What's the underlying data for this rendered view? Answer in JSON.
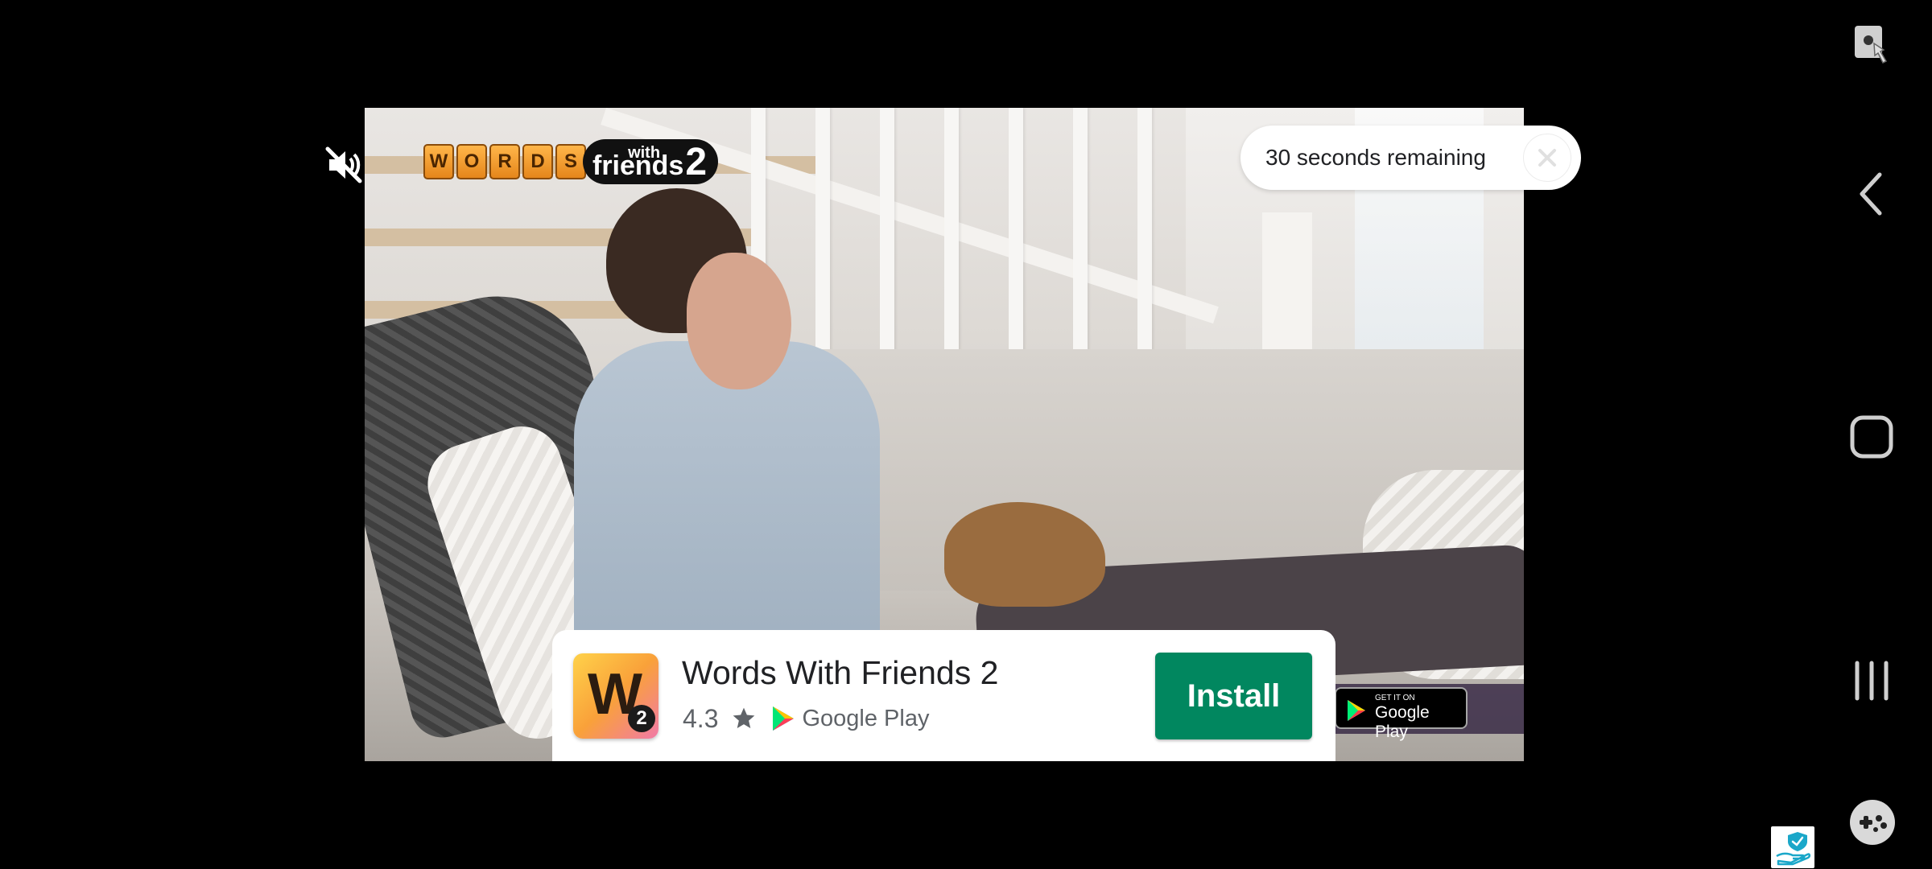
{
  "ad": {
    "timer_text": "30 seconds remaining",
    "brand_logo": {
      "letters": [
        "W",
        "O",
        "R",
        "D",
        "S"
      ],
      "with": "with",
      "friends": "friends",
      "number": "2"
    },
    "badge": {
      "small": "GET IT ON",
      "big": "Google Play"
    }
  },
  "install_card": {
    "app_name": "Words With Friends 2",
    "rating": "4.3",
    "store_name": "Google Play",
    "install_label": "Install",
    "icon_letter": "W",
    "icon_number": "2"
  },
  "icons": {
    "mute": "mute-speaker-icon",
    "close": "close-icon",
    "screenshot": "screenshot-touch-icon",
    "back": "back-chevron-icon",
    "home": "home-square-icon",
    "recents": "recents-bars-icon",
    "game_tools": "gamepad-icon",
    "shield": "shield-hand-icon"
  },
  "colors": {
    "install_green": "#01875f",
    "background": "#000000"
  }
}
